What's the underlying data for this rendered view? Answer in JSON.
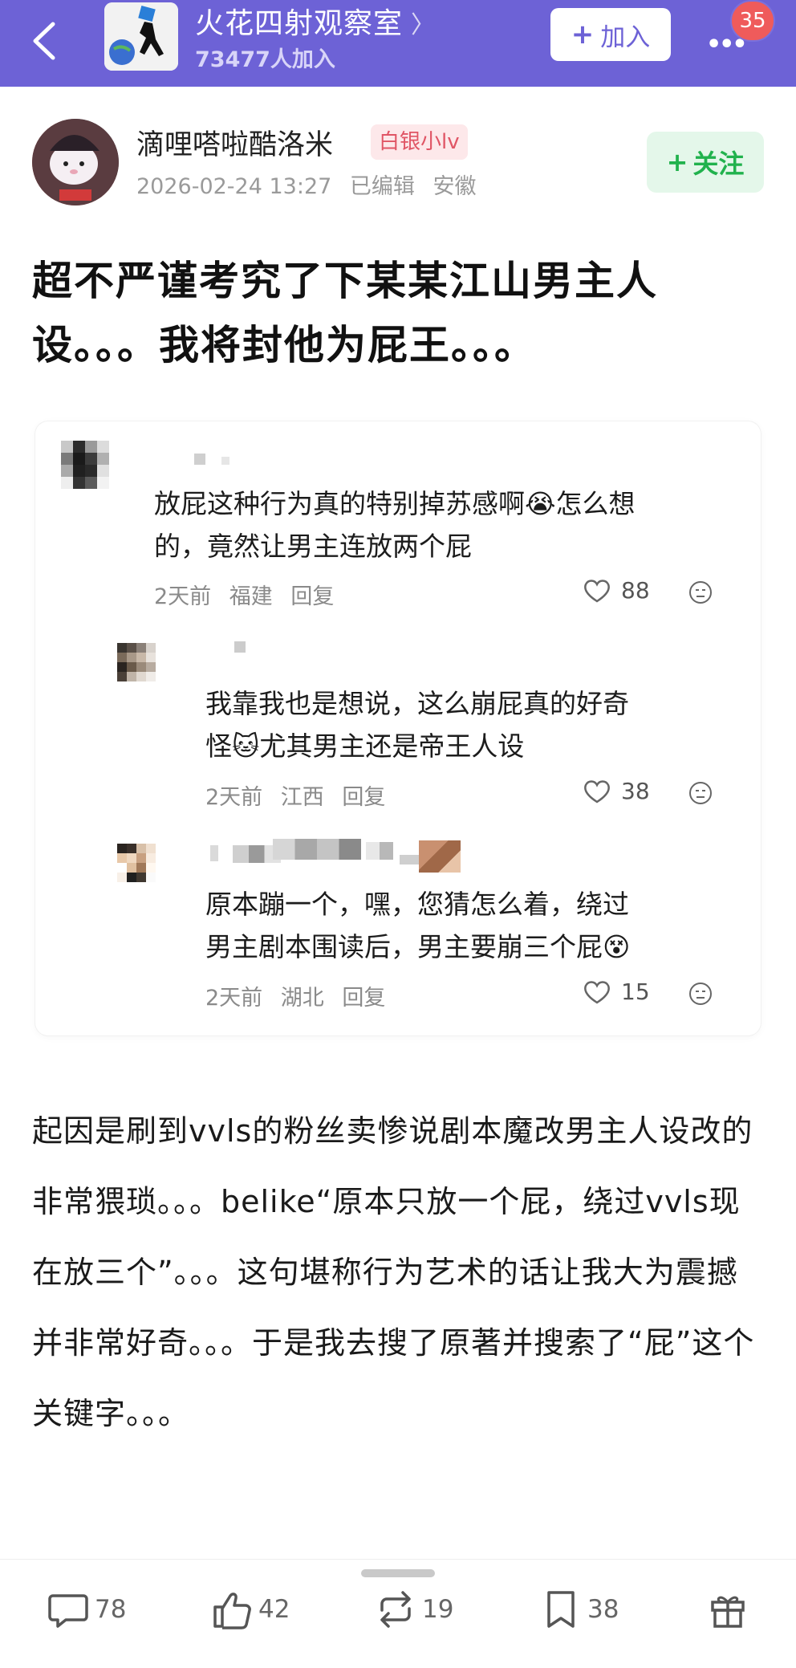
{
  "header": {
    "title": "火花四射观察室",
    "members": "73477人加入",
    "join_label": "加入",
    "notification_count": "35"
  },
  "post": {
    "author": "滴哩嗒啦酷洛米",
    "level": "白银小lv",
    "timestamp": "2026-02-24 13:27",
    "edited": "已编辑",
    "location": "安徽",
    "follow_label": "关注",
    "title": "超不严谨考究了下某某江山男主人设。。。我将封他为屁王。。。",
    "body": "起因是刷到vvls的粉丝卖惨说剧本魔改男主人设改的非常猥琐。。。belike“原本只放一个屁，绕过vvls现在放三个”。。。这句堪称行为艺术的话让我大为震撼并非常好奇。。。于是我去搜了原著并搜索了“屁”这个关键字。。。"
  },
  "comments": [
    {
      "text_line1": "放屁这种行为真的特别掉苏感啊😭怎么想",
      "text_line2": "的，竟然让男主连放两个屁",
      "time": "2天前",
      "region": "福建",
      "reply": "回复",
      "likes": "88"
    },
    {
      "text_line1": "我靠我也是想说，这么崩屁真的好奇",
      "text_line2": "怪🐱尤其男主还是帝王人设",
      "time": "2天前",
      "region": "江西",
      "reply": "回复",
      "likes": "38"
    },
    {
      "text_line1": "原本蹦一个，嘿，您猜怎么着，绕过",
      "text_line2": "男主剧本围读后，男主要崩三个屁😵",
      "time": "2天前",
      "region": "湖北",
      "reply": "回复",
      "likes": "15"
    }
  ],
  "toolbar": {
    "comments": "78",
    "likes": "42",
    "reposts": "19",
    "favorites": "38"
  },
  "colors": {
    "header_bg": "#6d62d6",
    "follow_green": "#21b24d",
    "badge_red": "#ef5b5b"
  }
}
